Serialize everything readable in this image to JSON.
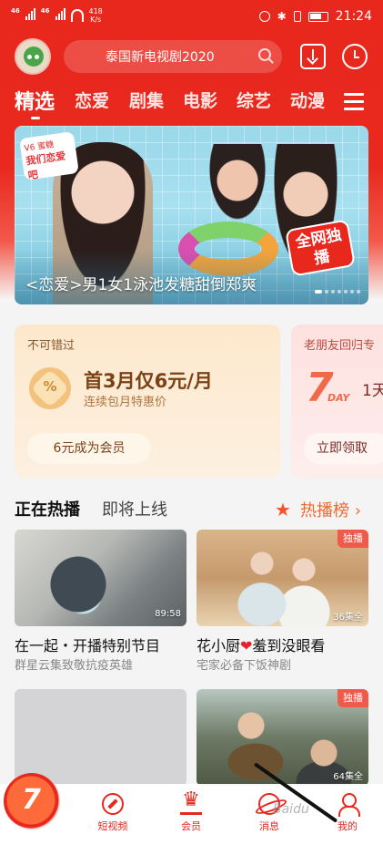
{
  "status_bar": {
    "network": "46",
    "network2": "46",
    "speed_value": "418",
    "speed_unit": "K/s",
    "time": "21:24"
  },
  "header": {
    "search_placeholder": "泰国新电视剧2020",
    "icons": [
      "avatar",
      "search-icon",
      "download-icon",
      "clock-icon"
    ]
  },
  "tabs": [
    "精选",
    "恋爱",
    "剧集",
    "电影",
    "综艺",
    "动漫"
  ],
  "active_tab": "精选",
  "banner": {
    "badge_top": "V6 蜜糖",
    "badge_bottom": "我们恋爱吧",
    "exclusive": "全网独播",
    "caption": "<恋爱>男1女1泳池发糖甜倒郑爽"
  },
  "promo_cards": [
    {
      "tag": "不可错过",
      "badge": "%",
      "title": "首3月仅6元/月",
      "subtitle": "连续包月特惠价",
      "button": "6元成为会员"
    },
    {
      "tag": "老朋友回归专",
      "big_number": "7",
      "unit": "DAY",
      "text": "1天",
      "button": "立即领取"
    }
  ],
  "section": {
    "tab_active": "正在热播",
    "tab_other": "即将上线",
    "rank_label": "热播榜 ›"
  },
  "videos": [
    {
      "title": "在一起・开播特别节目",
      "subtitle": "群星云集致敬抗疫英雄",
      "duration": "89:58",
      "badge": ""
    },
    {
      "title_pre": "花小厨",
      "title_heart": "❤",
      "title_post": "羞到没眼看",
      "subtitle": "宅家必备下饭神剧",
      "duration": "36集全",
      "badge": "独播"
    },
    {
      "title": "",
      "subtitle": "",
      "duration": "",
      "badge": ""
    },
    {
      "title": "",
      "subtitle": "",
      "duration": "64集全",
      "badge": "独播"
    }
  ],
  "bottom_nav": [
    {
      "label": "短视频",
      "icon": "compass-icon"
    },
    {
      "label": "会员",
      "icon": "crown-icon"
    },
    {
      "label": "消息",
      "icon": "planet-icon"
    },
    {
      "label": "我的",
      "icon": "person-icon"
    }
  ],
  "watermark": "Baidu"
}
